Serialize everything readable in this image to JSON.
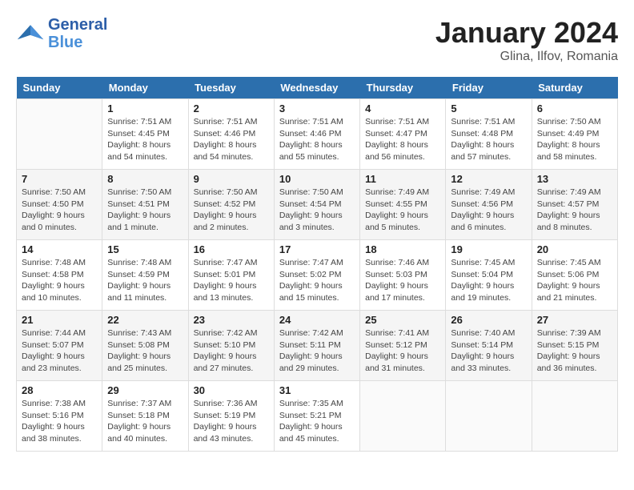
{
  "header": {
    "logo_line1": "General",
    "logo_line2": "Blue",
    "month_year": "January 2024",
    "location": "Glina, Ilfov, Romania"
  },
  "days_of_week": [
    "Sunday",
    "Monday",
    "Tuesday",
    "Wednesday",
    "Thursday",
    "Friday",
    "Saturday"
  ],
  "weeks": [
    [
      {
        "day": "",
        "sunrise": "",
        "sunset": "",
        "daylight": ""
      },
      {
        "day": "1",
        "sunrise": "7:51 AM",
        "sunset": "4:45 PM",
        "daylight": "8 hours and 54 minutes."
      },
      {
        "day": "2",
        "sunrise": "7:51 AM",
        "sunset": "4:46 PM",
        "daylight": "8 hours and 54 minutes."
      },
      {
        "day": "3",
        "sunrise": "7:51 AM",
        "sunset": "4:46 PM",
        "daylight": "8 hours and 55 minutes."
      },
      {
        "day": "4",
        "sunrise": "7:51 AM",
        "sunset": "4:47 PM",
        "daylight": "8 hours and 56 minutes."
      },
      {
        "day": "5",
        "sunrise": "7:51 AM",
        "sunset": "4:48 PM",
        "daylight": "8 hours and 57 minutes."
      },
      {
        "day": "6",
        "sunrise": "7:50 AM",
        "sunset": "4:49 PM",
        "daylight": "8 hours and 58 minutes."
      }
    ],
    [
      {
        "day": "7",
        "sunrise": "7:50 AM",
        "sunset": "4:50 PM",
        "daylight": "9 hours and 0 minutes."
      },
      {
        "day": "8",
        "sunrise": "7:50 AM",
        "sunset": "4:51 PM",
        "daylight": "9 hours and 1 minute."
      },
      {
        "day": "9",
        "sunrise": "7:50 AM",
        "sunset": "4:52 PM",
        "daylight": "9 hours and 2 minutes."
      },
      {
        "day": "10",
        "sunrise": "7:50 AM",
        "sunset": "4:54 PM",
        "daylight": "9 hours and 3 minutes."
      },
      {
        "day": "11",
        "sunrise": "7:49 AM",
        "sunset": "4:55 PM",
        "daylight": "9 hours and 5 minutes."
      },
      {
        "day": "12",
        "sunrise": "7:49 AM",
        "sunset": "4:56 PM",
        "daylight": "9 hours and 6 minutes."
      },
      {
        "day": "13",
        "sunrise": "7:49 AM",
        "sunset": "4:57 PM",
        "daylight": "9 hours and 8 minutes."
      }
    ],
    [
      {
        "day": "14",
        "sunrise": "7:48 AM",
        "sunset": "4:58 PM",
        "daylight": "9 hours and 10 minutes."
      },
      {
        "day": "15",
        "sunrise": "7:48 AM",
        "sunset": "4:59 PM",
        "daylight": "9 hours and 11 minutes."
      },
      {
        "day": "16",
        "sunrise": "7:47 AM",
        "sunset": "5:01 PM",
        "daylight": "9 hours and 13 minutes."
      },
      {
        "day": "17",
        "sunrise": "7:47 AM",
        "sunset": "5:02 PM",
        "daylight": "9 hours and 15 minutes."
      },
      {
        "day": "18",
        "sunrise": "7:46 AM",
        "sunset": "5:03 PM",
        "daylight": "9 hours and 17 minutes."
      },
      {
        "day": "19",
        "sunrise": "7:45 AM",
        "sunset": "5:04 PM",
        "daylight": "9 hours and 19 minutes."
      },
      {
        "day": "20",
        "sunrise": "7:45 AM",
        "sunset": "5:06 PM",
        "daylight": "9 hours and 21 minutes."
      }
    ],
    [
      {
        "day": "21",
        "sunrise": "7:44 AM",
        "sunset": "5:07 PM",
        "daylight": "9 hours and 23 minutes."
      },
      {
        "day": "22",
        "sunrise": "7:43 AM",
        "sunset": "5:08 PM",
        "daylight": "9 hours and 25 minutes."
      },
      {
        "day": "23",
        "sunrise": "7:42 AM",
        "sunset": "5:10 PM",
        "daylight": "9 hours and 27 minutes."
      },
      {
        "day": "24",
        "sunrise": "7:42 AM",
        "sunset": "5:11 PM",
        "daylight": "9 hours and 29 minutes."
      },
      {
        "day": "25",
        "sunrise": "7:41 AM",
        "sunset": "5:12 PM",
        "daylight": "9 hours and 31 minutes."
      },
      {
        "day": "26",
        "sunrise": "7:40 AM",
        "sunset": "5:14 PM",
        "daylight": "9 hours and 33 minutes."
      },
      {
        "day": "27",
        "sunrise": "7:39 AM",
        "sunset": "5:15 PM",
        "daylight": "9 hours and 36 minutes."
      }
    ],
    [
      {
        "day": "28",
        "sunrise": "7:38 AM",
        "sunset": "5:16 PM",
        "daylight": "9 hours and 38 minutes."
      },
      {
        "day": "29",
        "sunrise": "7:37 AM",
        "sunset": "5:18 PM",
        "daylight": "9 hours and 40 minutes."
      },
      {
        "day": "30",
        "sunrise": "7:36 AM",
        "sunset": "5:19 PM",
        "daylight": "9 hours and 43 minutes."
      },
      {
        "day": "31",
        "sunrise": "7:35 AM",
        "sunset": "5:21 PM",
        "daylight": "9 hours and 45 minutes."
      },
      {
        "day": "",
        "sunrise": "",
        "sunset": "",
        "daylight": ""
      },
      {
        "day": "",
        "sunrise": "",
        "sunset": "",
        "daylight": ""
      },
      {
        "day": "",
        "sunrise": "",
        "sunset": "",
        "daylight": ""
      }
    ]
  ]
}
